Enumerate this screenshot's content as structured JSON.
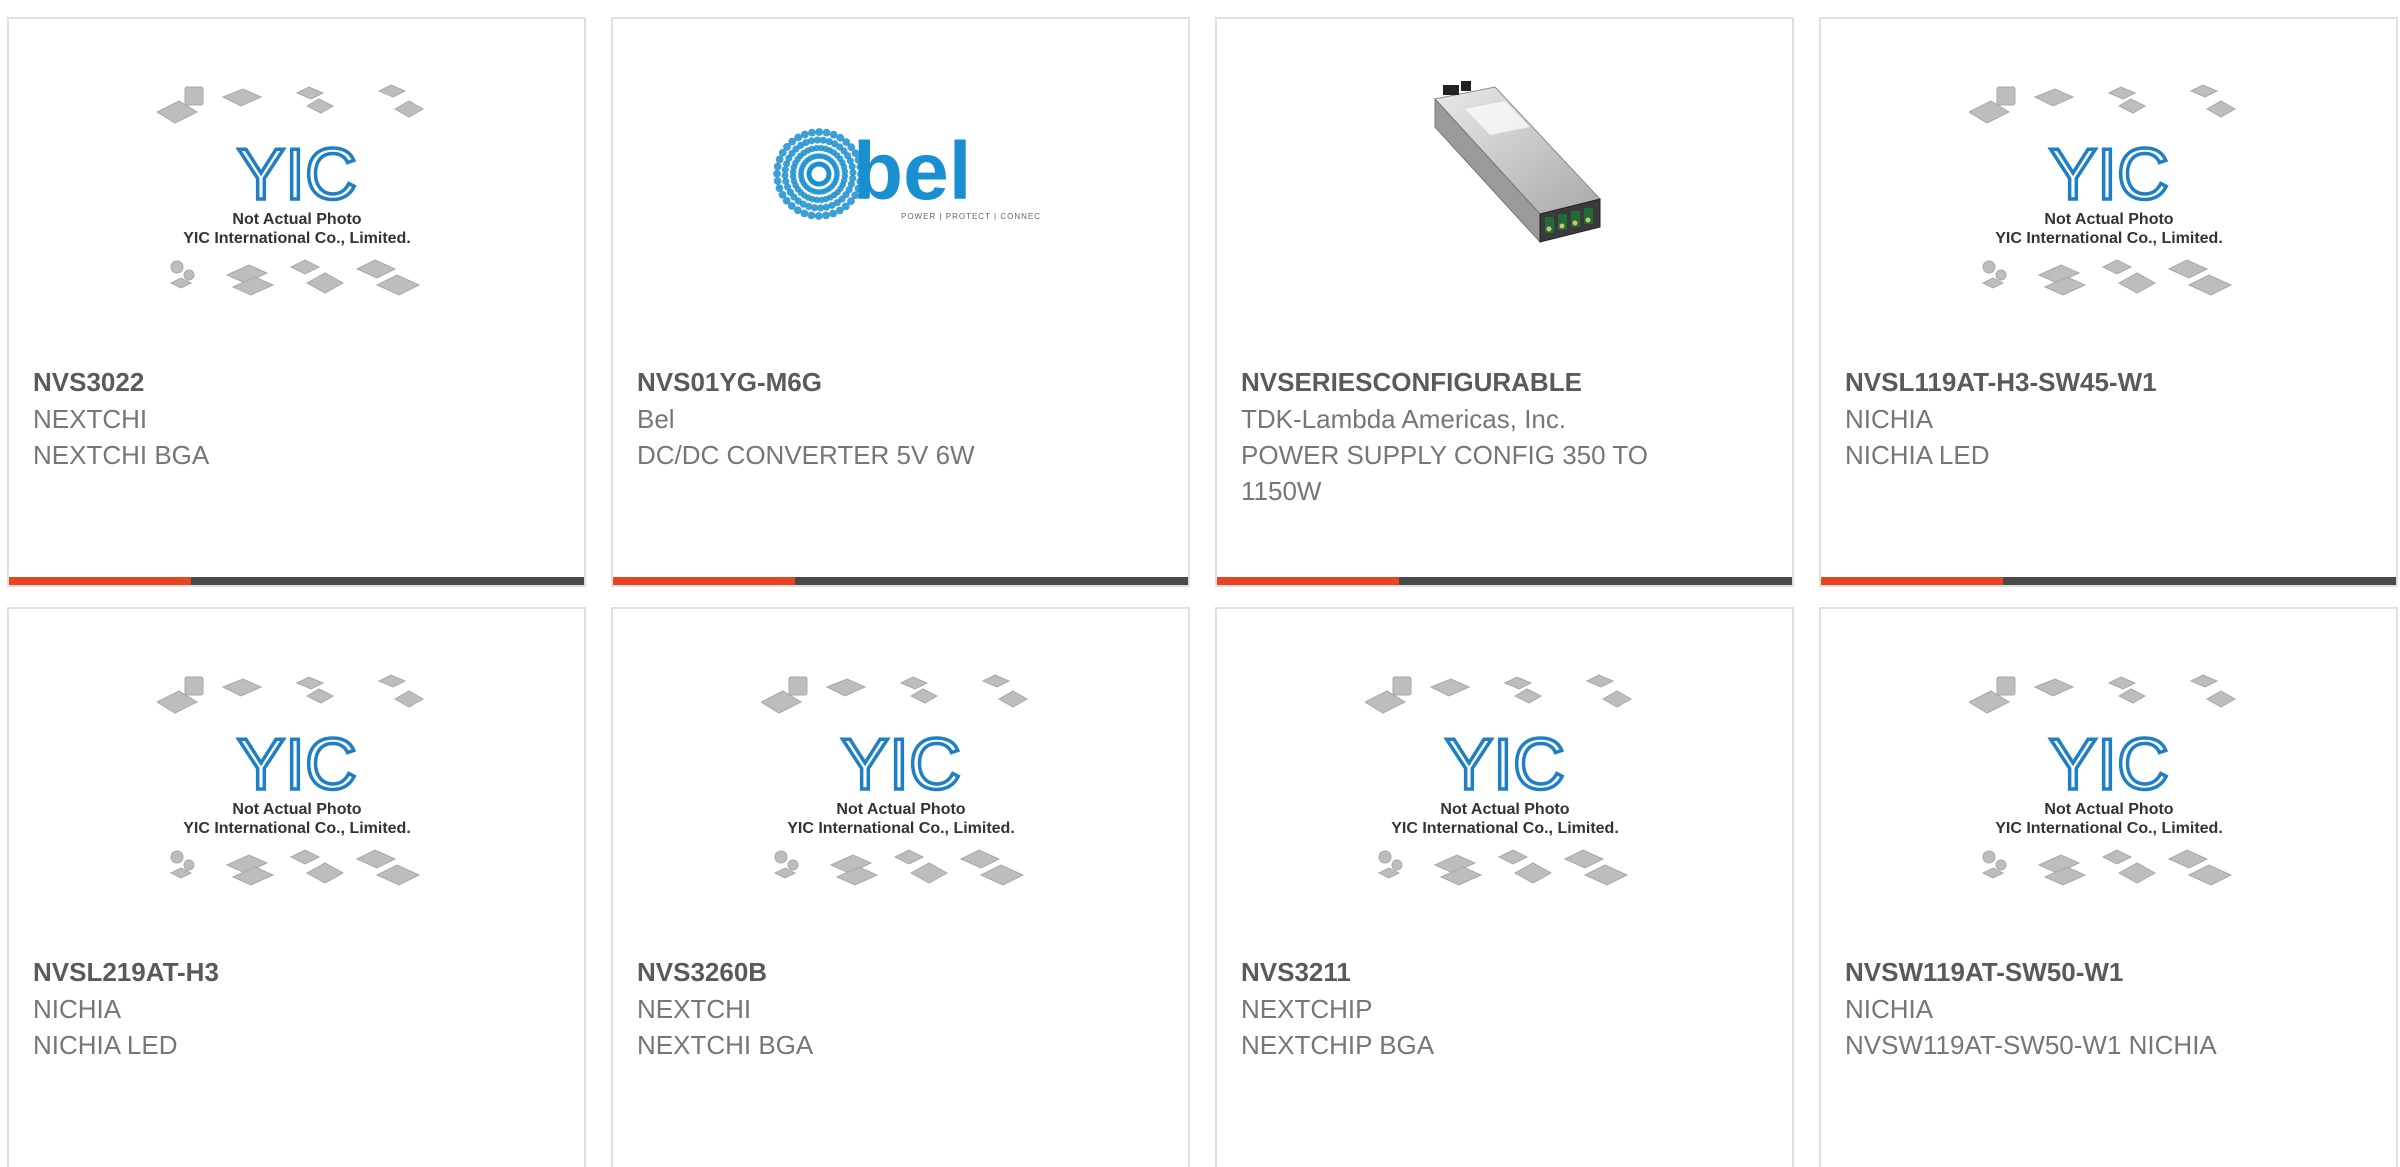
{
  "colors": {
    "accent": "#e8441f",
    "bar": "#4a4a4a",
    "border": "#e1e1e1",
    "part_text": "#5a5a5a",
    "sub_text": "#767676",
    "yic_blue": "#1f7fc4",
    "bel_blue": "#1a8fd0"
  },
  "placeholder": {
    "logo": "YIC",
    "line1": "Not Actual Photo",
    "line2": "YIC International Co., Limited."
  },
  "bel_logo": {
    "word": "bel",
    "tagline": "POWER | PROTECT | CONNECT"
  },
  "products": [
    {
      "part": "NVS3022",
      "manufacturer": "NEXTCHI",
      "description": "NEXTCHI BGA",
      "image": "yic-placeholder"
    },
    {
      "part": "NVS01YG-M6G",
      "manufacturer": "Bel",
      "description": "DC/DC CONVERTER 5V 6W",
      "image": "bel-logo"
    },
    {
      "part": "NVSERIESCONFIGURABLE",
      "manufacturer": "TDK-Lambda Americas, Inc.",
      "description": "POWER SUPPLY CONFIG 350 TO 1150W",
      "image": "power-supply-photo"
    },
    {
      "part": "NVSL119AT-H3-SW45-W1",
      "manufacturer": "NICHIA",
      "description": "NICHIA LED",
      "image": "yic-placeholder"
    },
    {
      "part": "NVSL219AT-H3",
      "manufacturer": "NICHIA",
      "description": "NICHIA LED",
      "image": "yic-placeholder"
    },
    {
      "part": "NVS3260B",
      "manufacturer": "NEXTCHI",
      "description": "NEXTCHI BGA",
      "image": "yic-placeholder"
    },
    {
      "part": "NVS3211",
      "manufacturer": "NEXTCHIP",
      "description": "NEXTCHIP BGA",
      "image": "yic-placeholder"
    },
    {
      "part": "NVSW119AT-SW50-W1",
      "manufacturer": "NICHIA",
      "description": "NVSW119AT-SW50-W1 NICHIA",
      "image": "yic-placeholder"
    }
  ]
}
